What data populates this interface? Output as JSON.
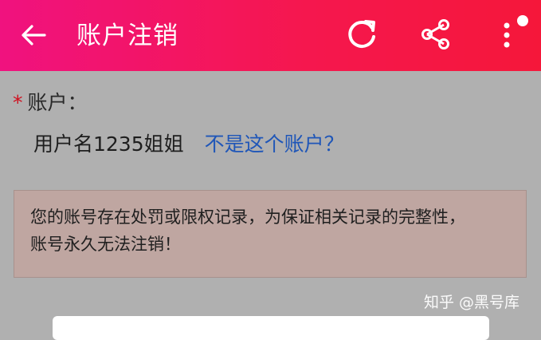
{
  "header": {
    "title": "账户注销",
    "icons": [
      "back-arrow-icon",
      "refresh-icon",
      "share-icon",
      "more-vertical-icon"
    ],
    "background": "#f5174f",
    "notification_dot": true
  },
  "account": {
    "label": "账户：",
    "username": "用户名1235姐姐",
    "switch_link": "不是这个账户？"
  },
  "notice": {
    "line1": "您的账号存在处罚或限权记录，为保证相关记录的完整性，",
    "line2": "账号永久无法注销！"
  },
  "watermark": "知乎 @黑号库",
  "colors": {
    "accent_link": "#1f56b8",
    "required_mark": "#d0101f",
    "overlay_background": "#b0b0b0"
  }
}
